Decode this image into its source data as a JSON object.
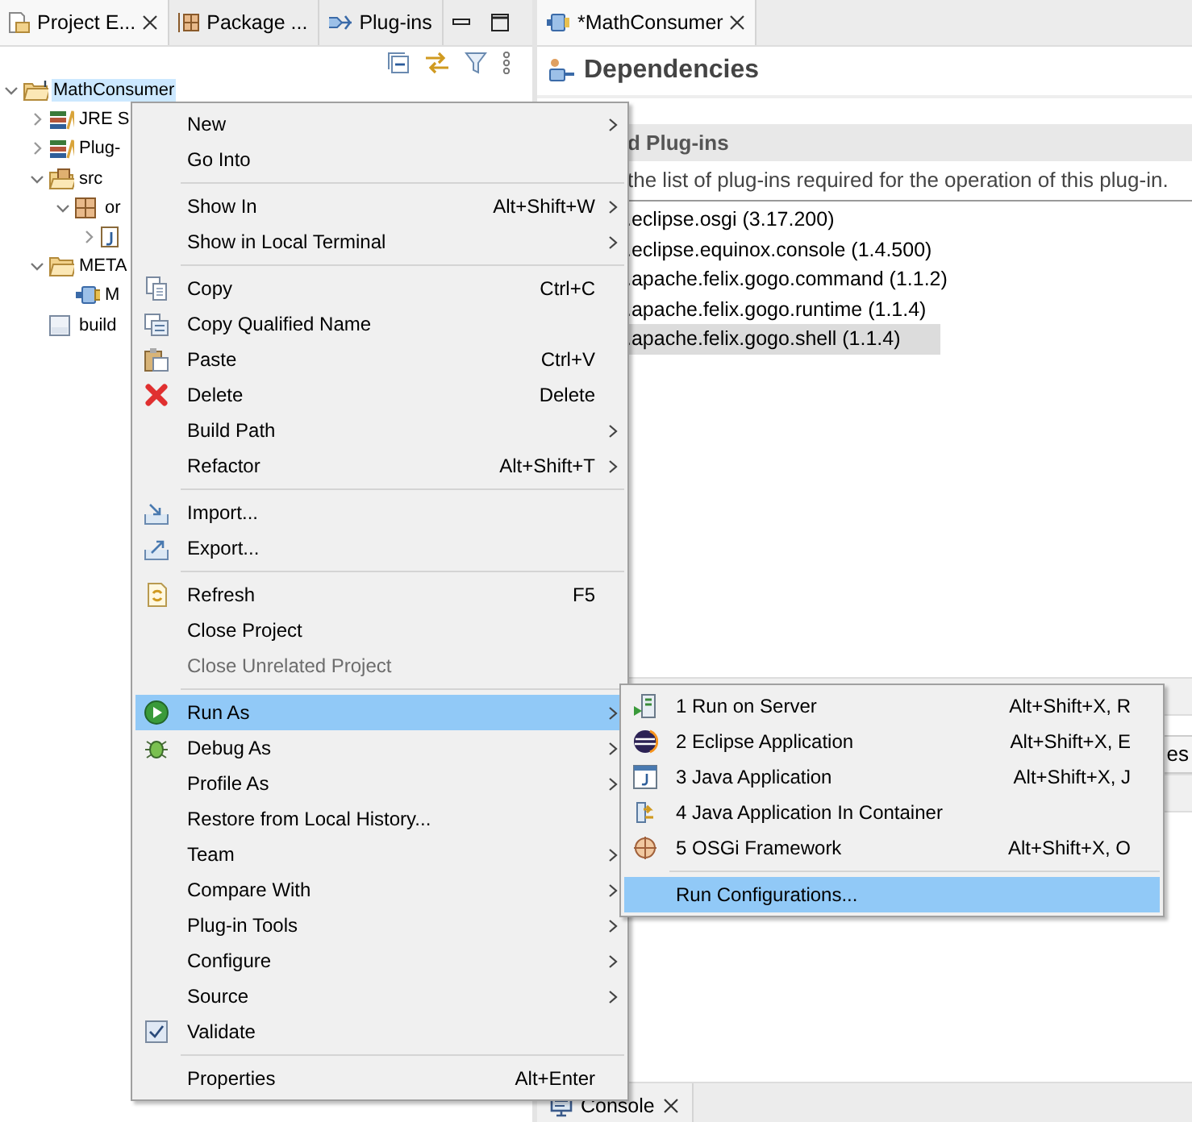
{
  "left_view": {
    "tabs": [
      {
        "label": "Project E...",
        "selected": true,
        "closable": true
      },
      {
        "label": "Package ...",
        "selected": false,
        "closable": false
      },
      {
        "label": "Plug-ins",
        "selected": false,
        "closable": false
      }
    ],
    "tree": [
      {
        "label": "MathConsumer",
        "kind": "project",
        "expanded": true,
        "selected": true,
        "children": [
          {
            "label": "JRE S",
            "kind": "library",
            "expanded": false,
            "selected": false
          },
          {
            "label": "Plug-",
            "kind": "library",
            "expanded": false,
            "selected": false
          },
          {
            "label": "src",
            "kind": "source-folder",
            "expanded": true,
            "selected": false,
            "children": [
              {
                "label": "or",
                "kind": "package",
                "expanded": true,
                "selected": false,
                "children": [
                  {
                    "kind": "java-file",
                    "expanded": false
                  }
                ]
              }
            ]
          },
          {
            "label": "META",
            "kind": "folder",
            "expanded": true,
            "selected": false,
            "children": [
              {
                "label": "M",
                "kind": "manifest",
                "selected": false
              }
            ]
          },
          {
            "label": "build",
            "kind": "binary-file",
            "selected": false
          }
        ]
      }
    ]
  },
  "editor": {
    "tab": {
      "label": "*MathConsumer",
      "selected": true
    },
    "title": "Dependencies",
    "section_title": "d Plug-ins",
    "section_description": "the list of plug-ins required for the operation of this plug-in.",
    "plugins": [
      {
        "label": ".eclipse.osgi (3.17.200)",
        "selected": false
      },
      {
        "label": ".eclipse.equinox.console (1.4.500)",
        "selected": false
      },
      {
        "label": ".apache.felix.gogo.command (1.1.2)",
        "selected": false
      },
      {
        "label": ".apache.felix.gogo.runtime (1.1.4)",
        "selected": false
      },
      {
        "label": ".apache.felix.gogo.shell (1.1.4)",
        "selected": true
      }
    ],
    "lower_tab": "es"
  },
  "bottom_tab": {
    "label": "Console",
    "selected": false
  },
  "context_menu": [
    {
      "kind": "item",
      "label": "New",
      "submenu": true,
      "selected": false,
      "disabled": false
    },
    {
      "kind": "item",
      "label": "Go Into",
      "selected": false,
      "disabled": false
    },
    {
      "kind": "separator"
    },
    {
      "kind": "item",
      "label": "Show In",
      "shortcut": "Alt+Shift+W",
      "submenu": true,
      "selected": false,
      "disabled": false
    },
    {
      "kind": "item",
      "label": "Show in Local Terminal",
      "submenu": true,
      "selected": false,
      "disabled": false
    },
    {
      "kind": "separator"
    },
    {
      "kind": "item",
      "label": "Copy",
      "shortcut": "Ctrl+C",
      "selected": false,
      "disabled": false
    },
    {
      "kind": "item",
      "label": "Copy Qualified Name",
      "selected": false,
      "disabled": false
    },
    {
      "kind": "item",
      "label": "Paste",
      "shortcut": "Ctrl+V",
      "selected": false,
      "disabled": false
    },
    {
      "kind": "item",
      "label": "Delete",
      "shortcut": "Delete",
      "selected": false,
      "disabled": false
    },
    {
      "kind": "item",
      "label": "Build Path",
      "submenu": true,
      "selected": false,
      "disabled": false
    },
    {
      "kind": "item",
      "label": "Refactor",
      "shortcut": "Alt+Shift+T",
      "submenu": true,
      "selected": false,
      "disabled": false
    },
    {
      "kind": "separator"
    },
    {
      "kind": "item",
      "label": "Import...",
      "selected": false,
      "disabled": false
    },
    {
      "kind": "item",
      "label": "Export...",
      "selected": false,
      "disabled": false
    },
    {
      "kind": "separator"
    },
    {
      "kind": "item",
      "label": "Refresh",
      "shortcut": "F5",
      "selected": false,
      "disabled": false
    },
    {
      "kind": "item",
      "label": "Close Project",
      "selected": false,
      "disabled": false
    },
    {
      "kind": "item",
      "label": "Close Unrelated Project",
      "selected": false,
      "disabled": true
    },
    {
      "kind": "separator"
    },
    {
      "kind": "item",
      "label": "Run As",
      "submenu": true,
      "selected": true,
      "disabled": false
    },
    {
      "kind": "item",
      "label": "Debug As",
      "submenu": true,
      "selected": false,
      "disabled": false
    },
    {
      "kind": "item",
      "label": "Profile As",
      "submenu": true,
      "selected": false,
      "disabled": false
    },
    {
      "kind": "item",
      "label": "Restore from Local History...",
      "selected": false,
      "disabled": false
    },
    {
      "kind": "item",
      "label": "Team",
      "submenu": true,
      "selected": false,
      "disabled": false
    },
    {
      "kind": "item",
      "label": "Compare With",
      "submenu": true,
      "selected": false,
      "disabled": false
    },
    {
      "kind": "item",
      "label": "Plug-in Tools",
      "submenu": true,
      "selected": false,
      "disabled": false
    },
    {
      "kind": "item",
      "label": "Configure",
      "submenu": true,
      "selected": false,
      "disabled": false
    },
    {
      "kind": "item",
      "label": "Source",
      "submenu": true,
      "selected": false,
      "disabled": false
    },
    {
      "kind": "item",
      "label": "Validate",
      "checked": true,
      "selected": false,
      "disabled": false
    },
    {
      "kind": "separator"
    },
    {
      "kind": "item",
      "label": "Properties",
      "shortcut": "Alt+Enter",
      "selected": false,
      "disabled": false
    }
  ],
  "run_as_submenu": [
    {
      "kind": "item",
      "label": "1 Run on Server",
      "shortcut": "Alt+Shift+X, R",
      "selected": false,
      "disabled": false
    },
    {
      "kind": "item",
      "label": "2 Eclipse Application",
      "shortcut": "Alt+Shift+X, E",
      "selected": false,
      "disabled": false
    },
    {
      "kind": "item",
      "label": "3 Java Application",
      "shortcut": "Alt+Shift+X, J",
      "selected": false,
      "disabled": false
    },
    {
      "kind": "item",
      "label": "4 Java Application In Container",
      "selected": false,
      "disabled": false
    },
    {
      "kind": "item",
      "label": "5 OSGi Framework",
      "shortcut": "Alt+Shift+X, O",
      "selected": false,
      "disabled": false
    },
    {
      "kind": "separator"
    },
    {
      "kind": "item",
      "label": "Run Configurations...",
      "selected": true,
      "disabled": false
    }
  ]
}
